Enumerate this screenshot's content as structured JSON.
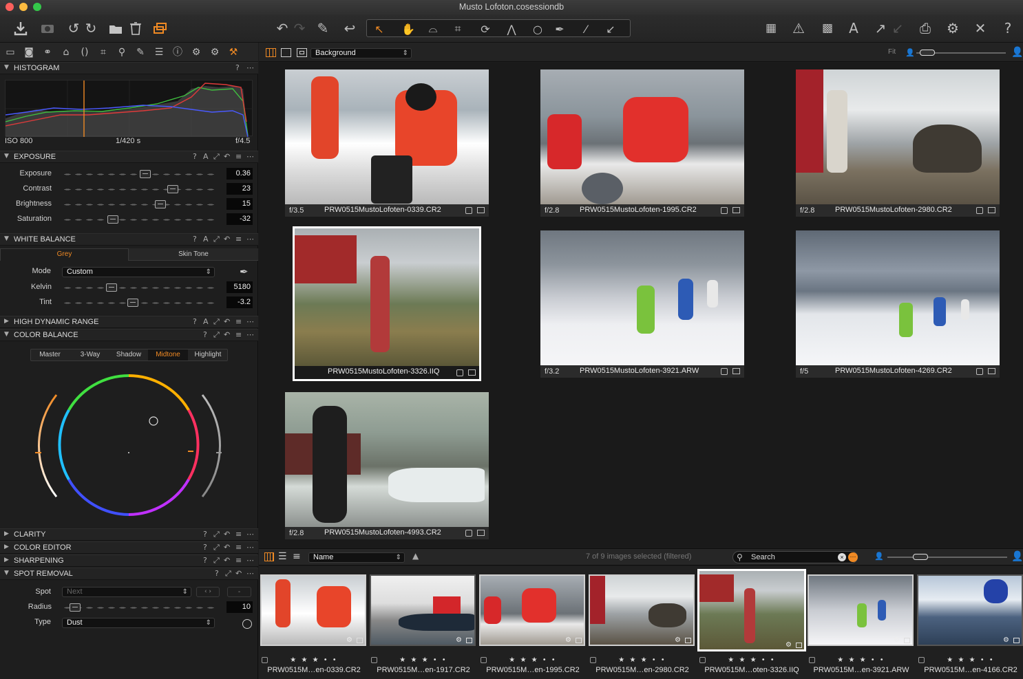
{
  "window": {
    "title": "Musto Lofoton.cosessiondb"
  },
  "histogram": {
    "title": "HISTOGRAM",
    "iso": "ISO 800",
    "shutter": "1/420 s",
    "aperture": "f/4.5"
  },
  "exposure": {
    "title": "EXPOSURE",
    "sliders": [
      {
        "label": "Exposure",
        "value": "0.36",
        "pos": 0.54
      },
      {
        "label": "Contrast",
        "value": "23",
        "pos": 0.72
      },
      {
        "label": "Brightness",
        "value": "15",
        "pos": 0.64
      },
      {
        "label": "Saturation",
        "value": "-32",
        "pos": 0.33
      }
    ]
  },
  "white_balance": {
    "title": "WHITE BALANCE",
    "tabs": [
      "Grey",
      "Skin Tone"
    ],
    "mode_label": "Mode",
    "mode_value": "Custom",
    "sliders": [
      {
        "label": "Kelvin",
        "value": "5180",
        "pos": 0.32
      },
      {
        "label": "Tint",
        "value": "-3.2",
        "pos": 0.46
      }
    ]
  },
  "hdr": {
    "title": "HIGH DYNAMIC RANGE"
  },
  "color_balance": {
    "title": "COLOR BALANCE",
    "tabs": [
      "Master",
      "3-Way",
      "Shadow",
      "Midtone",
      "Highlight"
    ],
    "active_tab": "Midtone"
  },
  "clarity": {
    "title": "CLARITY"
  },
  "color_editor": {
    "title": "COLOR EDITOR"
  },
  "sharpening": {
    "title": "SHARPENING"
  },
  "spot_removal": {
    "title": "SPOT REMOVAL",
    "spot_label": "Spot",
    "spot_value": "Next",
    "radius_label": "Radius",
    "radius_value": "10",
    "radius_pos": 0.05,
    "type_label": "Type",
    "type_value": "Dust"
  },
  "viewer": {
    "background_select": "Background",
    "fit_label": "Fit",
    "thumbs": [
      {
        "aperture": "f/3.5",
        "name": "PRW0515MustoLofoten-0339.CR2"
      },
      {
        "aperture": "f/2.8",
        "name": "PRW0515MustoLofoten-1995.CR2"
      },
      {
        "aperture": "f/2.8",
        "name": "PRW0515MustoLofoten-2980.CR2"
      },
      {
        "aperture": "",
        "name": "PRW0515MustoLofoten-3326.IIQ"
      },
      {
        "aperture": "f/3.2",
        "name": "PRW0515MustoLofoten-3921.ARW"
      },
      {
        "aperture": "f/5",
        "name": "PRW0515MustoLofoten-4269.CR2"
      },
      {
        "aperture": "f/2.8",
        "name": "PRW0515MustoLofoten-4993.CR2"
      }
    ]
  },
  "browser": {
    "sort_label": "Name",
    "count_text": "7 of 9 images selected (filtered)",
    "search_placeholder": "Search",
    "items": [
      {
        "stars": "★ ★ ★ •  •",
        "name": "PRW0515M…en-0339.CR2"
      },
      {
        "stars": "★ ★ ★ •  •",
        "name": "PRW0515M…en-1917.CR2"
      },
      {
        "stars": "★ ★ ★ •  •",
        "name": "PRW0515M…en-1995.CR2"
      },
      {
        "stars": "★ ★ ★ •  •",
        "name": "PRW0515M…en-2980.CR2"
      },
      {
        "stars": "★ ★ ★ •  •",
        "name": "PRW0515M…oten-3326.IIQ"
      },
      {
        "stars": "★ ★ ★ •  •",
        "name": "PRW0515M…en-3921.ARW"
      },
      {
        "stars": "★ ★ ★ •  •",
        "name": "PRW0515M…en-4166.CR2"
      }
    ]
  },
  "colors": {
    "accent": "#f08a24",
    "panel": "#1e1e1e",
    "viewer": "#1a1a1a"
  }
}
